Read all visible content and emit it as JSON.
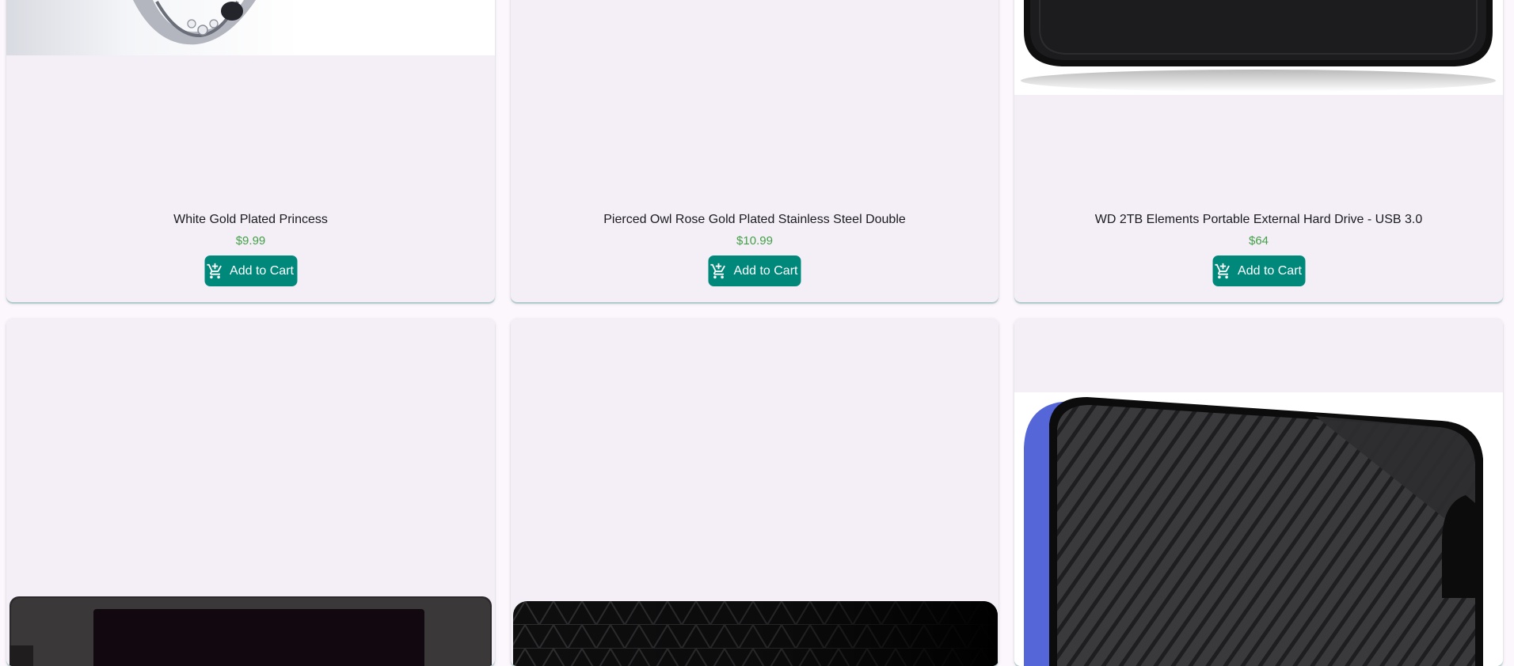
{
  "products_row_top": [
    {
      "title": "White Gold Plated Princess",
      "price": "$9.99",
      "cart_label": "Add to Cart"
    },
    {
      "title": "Pierced Owl Rose Gold Plated Stainless Steel Double",
      "price": "$10.99",
      "cart_label": "Add to Cart"
    },
    {
      "title": "WD 2TB Elements Portable External Hard Drive - USB 3.0",
      "price": "$64",
      "cart_label": "Add to Cart"
    }
  ],
  "icons": {
    "cart": "add-shopping-cart-icon"
  },
  "colors": {
    "page_background": "#fcf7fd",
    "card_background": "#f4eff7",
    "button": "#00897b",
    "price": "#43a047",
    "title": "#1b1b1f"
  }
}
